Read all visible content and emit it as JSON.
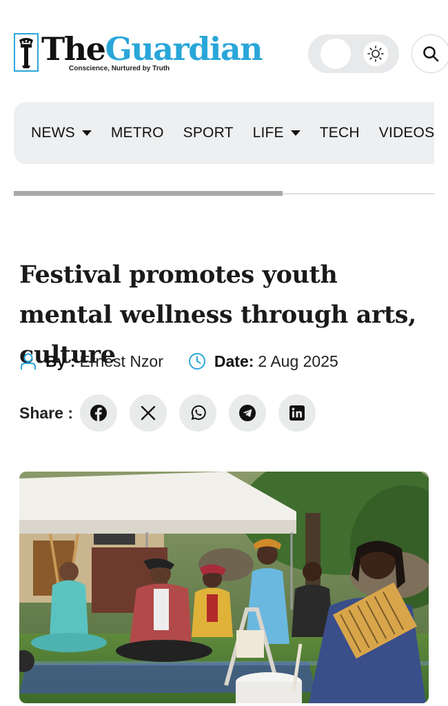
{
  "brand": {
    "name_part1": "The",
    "name_part2": "Guardian",
    "tagline": "Conscience, Nurtured by Truth",
    "accent_color": "#2aa6d9"
  },
  "header": {
    "theme_toggle_icon": "sun-icon",
    "search_icon": "search-icon"
  },
  "nav": {
    "items": [
      {
        "label": "NEWS",
        "has_dropdown": true
      },
      {
        "label": "METRO",
        "has_dropdown": false
      },
      {
        "label": "SPORT",
        "has_dropdown": false
      },
      {
        "label": "LIFE",
        "has_dropdown": true
      },
      {
        "label": "TECH",
        "has_dropdown": false
      },
      {
        "label": "VIDEOS",
        "has_dropdown": false
      }
    ]
  },
  "reading_progress": 0.64,
  "article": {
    "headline": "Festival promotes youth mental wellness through arts, culture",
    "author_label": "By :",
    "author": "Ernest Nzor",
    "date_label": "Date:",
    "date": "2 Aug 2025"
  },
  "share": {
    "label": "Share :",
    "buttons": [
      "facebook-icon",
      "x-icon",
      "whatsapp-icon",
      "telegram-icon",
      "linkedin-icon"
    ]
  }
}
